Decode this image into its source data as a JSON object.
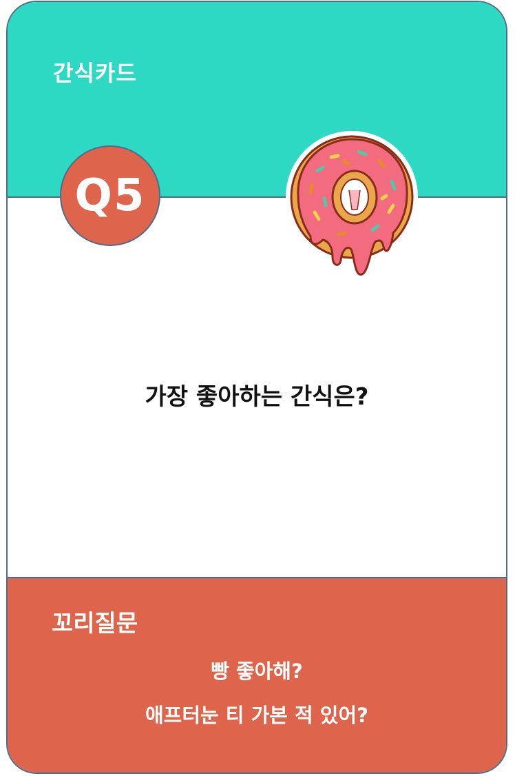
{
  "card": {
    "category": "간식카드",
    "number": "Q5",
    "question": "가장 좋아하는 간식은?",
    "follow_up_title": "꼬리질문",
    "follow_up_questions": [
      "빵 좋아해?",
      "애프터눈 티 가본 적 있어?"
    ]
  },
  "colors": {
    "top": "#2dd9c3",
    "bottom": "#de644b",
    "border": "#4a6d8c",
    "donut_icing": "#f36b7f"
  },
  "icons": {
    "illustration": "donut-icon"
  }
}
